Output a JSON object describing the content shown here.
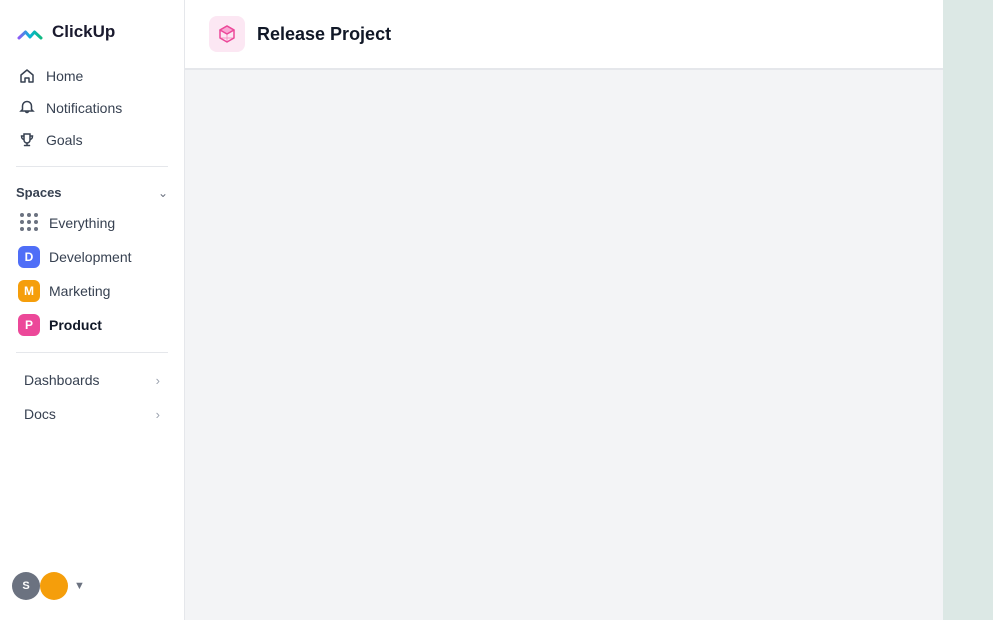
{
  "app": {
    "name": "ClickUp"
  },
  "sidebar": {
    "nav": [
      {
        "id": "home",
        "label": "Home",
        "icon": "home"
      },
      {
        "id": "notifications",
        "label": "Notifications",
        "icon": "bell"
      },
      {
        "id": "goals",
        "label": "Goals",
        "icon": "trophy"
      }
    ],
    "spaces_label": "Spaces",
    "spaces": [
      {
        "id": "everything",
        "label": "Everything",
        "type": "dots"
      },
      {
        "id": "development",
        "label": "Development",
        "type": "badge",
        "letter": "D",
        "color": "badge-blue"
      },
      {
        "id": "marketing",
        "label": "Marketing",
        "type": "badge",
        "letter": "M",
        "color": "badge-yellow"
      },
      {
        "id": "product",
        "label": "Product",
        "type": "badge",
        "letter": "P",
        "color": "badge-pink",
        "active": true
      }
    ],
    "sections": [
      {
        "id": "dashboards",
        "label": "Dashboards"
      },
      {
        "id": "docs",
        "label": "Docs"
      }
    ],
    "user_initials": "S"
  },
  "header": {
    "project_title": "Release Project"
  }
}
